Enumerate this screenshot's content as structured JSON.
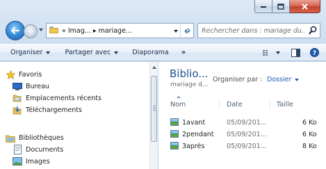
{
  "window": {
    "caption_buttons": [
      "minimize",
      "maximize",
      "close"
    ]
  },
  "address_bar": {
    "path": "« Imag... ▸ mariage..."
  },
  "search": {
    "placeholder": "Rechercher dans : mariage du..."
  },
  "toolbar": {
    "organize": "Organiser",
    "share": "Partager avec",
    "slideshow": "Diaporama",
    "more": "»"
  },
  "nav_pane": {
    "favorites_header": "Favoris",
    "favorites": [
      {
        "label": "Bureau",
        "icon": "desktop-icon"
      },
      {
        "label": "Emplacements récents",
        "icon": "recent-places-icon"
      },
      {
        "label": "Téléchargements",
        "icon": "downloads-icon"
      }
    ],
    "libraries_header": "Bibliothèques",
    "libraries": [
      {
        "label": "Documents",
        "icon": "documents-icon"
      },
      {
        "label": "Images",
        "icon": "pictures-icon"
      }
    ]
  },
  "content": {
    "library_title": "Biblio...",
    "library_subtitle": "mariage d...",
    "arrange_label": "Organiser par :",
    "arrange_value": "Dossier",
    "columns": {
      "name": "Nom",
      "date": "Date",
      "size": "Taille"
    },
    "files": [
      {
        "name": "1avant",
        "date": "05/09/201...",
        "size": "6 Ko"
      },
      {
        "name": "2pendant",
        "date": "05/09/201...",
        "size": "6 Ko"
      },
      {
        "name": "3après",
        "date": "05/09/201...",
        "size": "8 Ko"
      }
    ]
  },
  "colors": {
    "frame": "#c6d9ef",
    "library_title": "#1c4f8f",
    "arrange_value": "#1a5ab5",
    "close_button": "#c4422d"
  }
}
